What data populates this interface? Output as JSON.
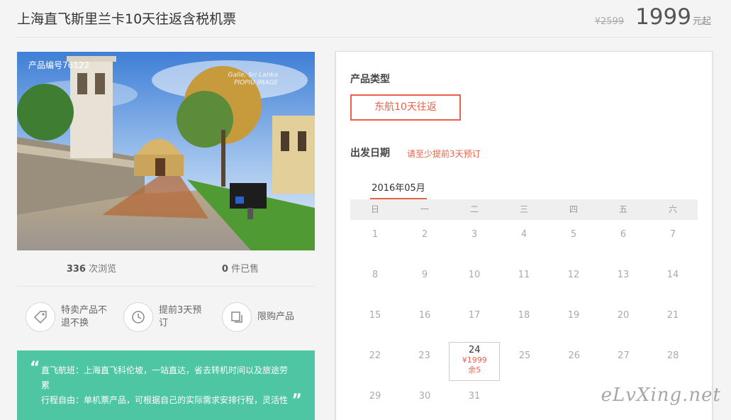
{
  "header": {
    "title": "上海直飞斯里兰卡10天往返含税机票",
    "old_price": "¥2599",
    "price": "1999",
    "price_unit": "元起"
  },
  "photo": {
    "product_code": "产品编号76122",
    "watermark_line1": "Galle, Sri Lanka",
    "watermark_line2": "PIOPIU IMAGE",
    "sign_text": "GALLE ARCHAEOLOGY MUSEUM"
  },
  "stats": {
    "views_count": "336",
    "views_label": "次浏览",
    "sold_count": "0",
    "sold_label": "件已售"
  },
  "features": [
    {
      "icon": "tag-icon",
      "line1": "特卖产品不",
      "line2": "退不换"
    },
    {
      "icon": "clock-icon",
      "line1": "提前3天预",
      "line2": "订"
    },
    {
      "icon": "copy-icon",
      "line1": "限购产品",
      "line2": ""
    }
  ],
  "description": {
    "line1": "直飞航班：上海直飞科伦坡，一站直达，省去转机时间以及旅途劳",
    "line2": "累",
    "line3": "行程自由：单机票产品，可根据自己的实际需求安排行程，灵活性"
  },
  "booking": {
    "type_title": "产品类型",
    "type_option": "东航10天往返",
    "date_title": "出发日期",
    "date_note": "请至少提前3天预订",
    "month": "2016年05月",
    "weekdays": [
      "日",
      "一",
      "二",
      "三",
      "四",
      "五",
      "六"
    ],
    "weeks": [
      [
        "1",
        "2",
        "3",
        "4",
        "5",
        "6",
        "7"
      ],
      [
        "8",
        "9",
        "10",
        "11",
        "12",
        "13",
        "14"
      ],
      [
        "15",
        "16",
        "17",
        "18",
        "19",
        "20",
        "21"
      ],
      [
        "22",
        "23",
        "24",
        "25",
        "26",
        "27",
        "28"
      ],
      [
        "29",
        "30",
        "31",
        "",
        "",
        "",
        ""
      ]
    ],
    "available": {
      "day": "24",
      "price": "¥1999",
      "remaining": "余5"
    }
  },
  "site_watermark": "eLvXing.net",
  "colors": {
    "accent": "#e8614a",
    "green": "#4fc6a3"
  }
}
